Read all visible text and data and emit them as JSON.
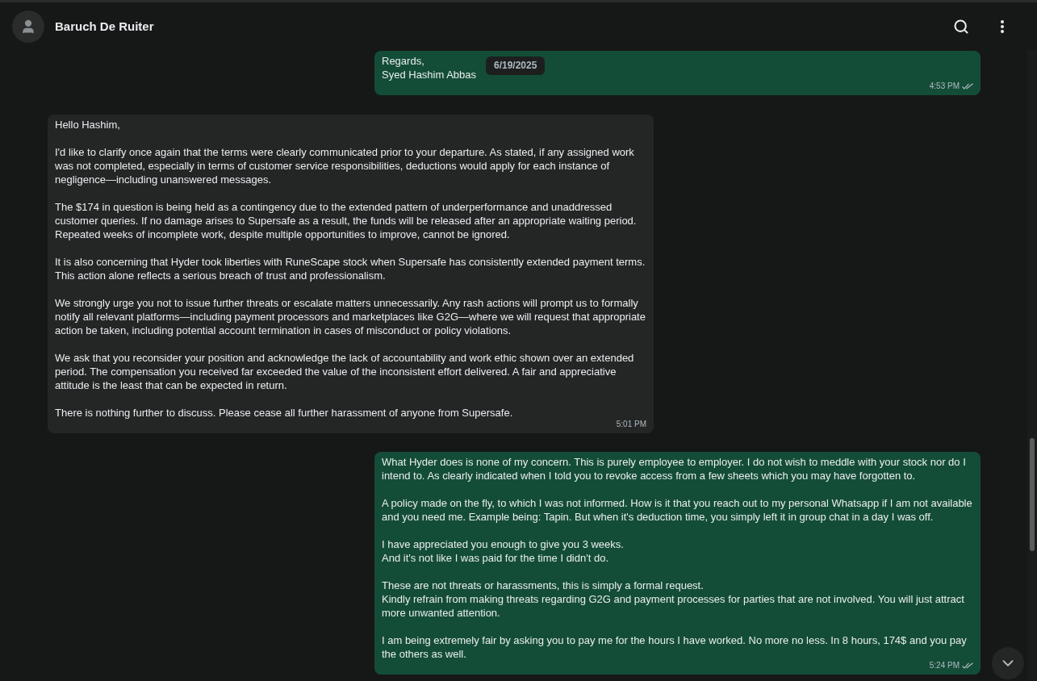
{
  "header": {
    "contact_name": "Baruch De Ruiter"
  },
  "messages": [
    {
      "kind": "outgoing",
      "paragraphs": [
        "Regards,\nSyed Hashim Abbas"
      ],
      "date_chip": "6/19/2025",
      "time": "4:53 PM",
      "read": true
    },
    {
      "kind": "incoming",
      "paragraphs": [
        "Hello Hashim,",
        "I'd like to clarify once again that the terms were clearly communicated prior to your departure. As stated, if any assigned work was not completed, especially in terms of customer service responsibilities, deductions would apply for each instance of negligence—including unanswered messages.",
        "The $174 in question is being held as a contingency due to the extended pattern of underperformance and unaddressed customer queries. If no damage arises to Supersafe as a result, the funds will be released after an appropriate waiting period. Repeated weeks of incomplete work, despite multiple opportunities to improve, cannot be ignored.",
        "It is also concerning that Hyder took liberties with RuneScape stock when Supersafe has consistently extended payment terms. This action alone reflects a serious breach of trust and professionalism.",
        "We strongly urge you not to issue further threats or escalate matters unnecessarily. Any rash actions will prompt us to formally notify all relevant platforms—including payment processors and marketplaces like G2G—where we will request that appropriate action be taken, including potential account termination in cases of misconduct or policy violations.",
        "We ask that you reconsider your position and acknowledge the lack of accountability and work ethic shown over an extended period. The compensation you received far exceeded the value of the inconsistent effort delivered. A fair and appreciative attitude is the least that can be expected in return.",
        "There is nothing further to discuss. Please cease all further harassment of anyone from Supersafe."
      ],
      "time": "5:01 PM"
    },
    {
      "kind": "outgoing",
      "paragraphs": [
        "What Hyder does is none of my concern. This is purely employee to employer. I do not wish to meddle with your stock nor do I intend to. As clearly indicated when I told you to revoke access from a few sheets which you may have forgotten to.",
        "A policy made on the fly, to which I was not informed. How is it that you reach out to my personal Whatsapp if I am not available and you need me. Example being: Tapin. But when it's deduction time,  you simply left it in group chat in a day I was off.",
        "I have appreciated you enough to give you 3 weeks.\nAnd it's not like I was paid for the time I didn't do.",
        "These are not threats or harassments, this is simply a formal request.\nKindly refrain from making threats regarding G2G and payment processes for parties that are not involved. You will just attract more unwanted attention.",
        "I am being extremely fair by asking you to pay me for the hours I have worked. No more no less. In 8 hours, 174$ and you pay the others as well."
      ],
      "time": "5:24 PM",
      "read": true
    }
  ]
}
